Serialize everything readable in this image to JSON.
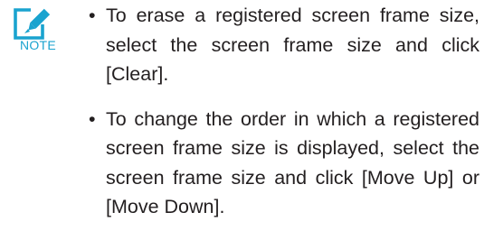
{
  "note": {
    "label": "NOTE",
    "icon": "note-pencil-icon",
    "accent_color": "#1aa3cf"
  },
  "items": [
    {
      "bullet": "•",
      "text": "To erase a registered screen frame size, select the screen frame size and click [Clear]."
    },
    {
      "bullet": "•",
      "text": "To change the order in which a registered screen frame size is displayed, select the screen frame size and click [Move Up] or [Move Down]."
    }
  ]
}
